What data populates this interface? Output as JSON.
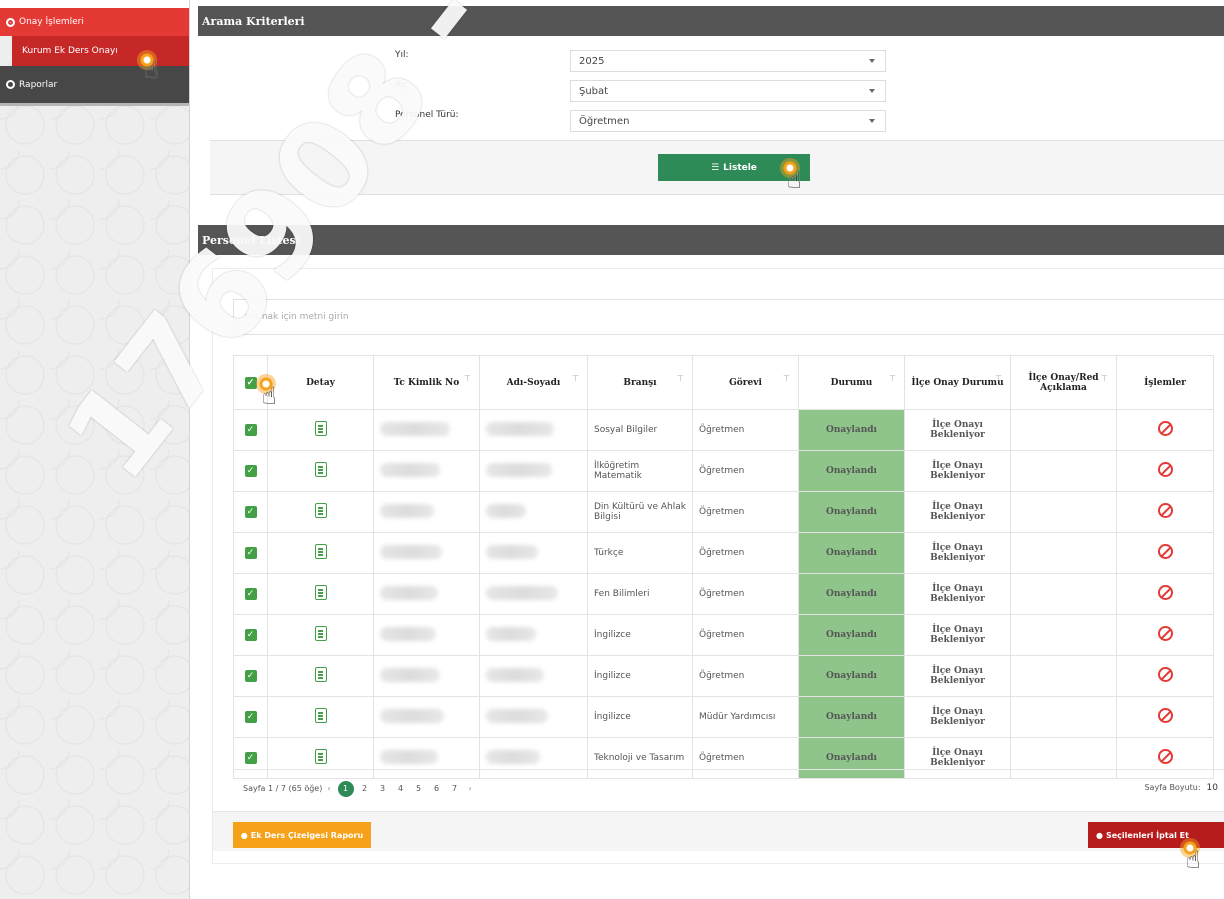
{
  "sidebar": {
    "items": [
      {
        "label": "Onay İşlemleri"
      },
      {
        "label": "Kurum Ek Ders Onayı"
      },
      {
        "label": "Raporlar"
      }
    ]
  },
  "criteria": {
    "title": "Arama Kriterleri",
    "year_label": "Yıl:",
    "year_value": "2025",
    "month_label": "Ay:",
    "month_value": "Şubat",
    "staff_type_label": "Personel Türü:",
    "staff_type_value": "Öğretmen",
    "list_button": "Listele",
    "list_icon": "list-icon"
  },
  "staff_list": {
    "title": "Personel Listesi",
    "search_placeholder": "aramak için metni girin",
    "columns": [
      "Detay",
      "Tc Kimlik No",
      "Adı-Soyadı",
      "Branşı",
      "Görevi",
      "Durumu",
      "İlçe Onay Durumu",
      "İlçe Onay/Red Açıklama",
      "İşlemler"
    ],
    "rows": [
      {
        "brans": "Sosyal Bilgiler",
        "gorev": "Öğretmen",
        "durum": "Onaylandı",
        "ilce": "İlçe Onayı Bekleniyor"
      },
      {
        "brans": "İlköğretim Matematik",
        "gorev": "Öğretmen",
        "durum": "Onaylandı",
        "ilce": "İlçe Onayı Bekleniyor"
      },
      {
        "brans": "Din Kültürü ve Ahlak Bilgisi",
        "gorev": "Öğretmen",
        "durum": "Onaylandı",
        "ilce": "İlçe Onayı Bekleniyor"
      },
      {
        "brans": "Türkçe",
        "gorev": "Öğretmen",
        "durum": "Onaylandı",
        "ilce": "İlçe Onayı Bekleniyor"
      },
      {
        "brans": "Fen Bilimleri",
        "gorev": "Öğretmen",
        "durum": "Onaylandı",
        "ilce": "İlçe Onayı Bekleniyor"
      },
      {
        "brans": "İngilizce",
        "gorev": "Öğretmen",
        "durum": "Onaylandı",
        "ilce": "İlçe Onayı Bekleniyor"
      },
      {
        "brans": "İngilizce",
        "gorev": "Öğretmen",
        "durum": "Onaylandı",
        "ilce": "İlçe Onayı Bekleniyor"
      },
      {
        "brans": "İngilizce",
        "gorev": "Müdür Yardımcısı",
        "durum": "Onaylandı",
        "ilce": "İlçe Onayı Bekleniyor"
      },
      {
        "brans": "Teknoloji ve Tasarım",
        "gorev": "Öğretmen",
        "durum": "Onaylandı",
        "ilce": "İlçe Onayı Bekleniyor"
      }
    ],
    "pager": {
      "info": "Sayfa 1 / 7 (65 öğe)",
      "prev": "‹",
      "next": "›",
      "pages": [
        "1",
        "2",
        "3",
        "4",
        "5",
        "6",
        "7"
      ],
      "active_page": "1",
      "size_label": "Sayfa Boyutu:",
      "size_value": "10"
    },
    "report_button": "Ek Ders Çizelgesi Raporu",
    "cancel_selected_button": "Seçilenleri İptal Et"
  },
  "watermark": "176908 - 1604476908 -"
}
